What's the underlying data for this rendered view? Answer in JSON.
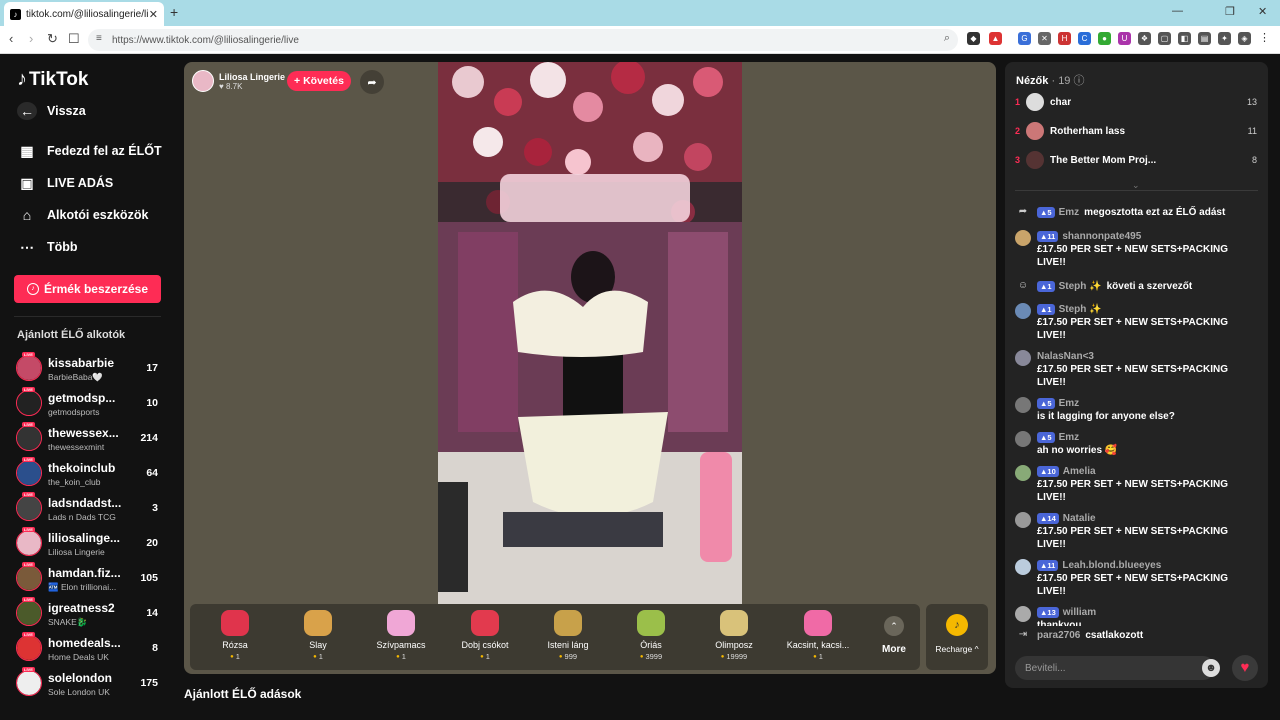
{
  "browser": {
    "tab_title": "tiktok.com/@liliosalingerie/li",
    "tab_close": "✕",
    "new_tab": "+",
    "url": "https://www.tiktok.com/@liliosalingerie/live",
    "win_minimize": "—",
    "win_maximize": "❐",
    "win_close": "✕"
  },
  "sidebar": {
    "logo": "TikTok",
    "back": "Vissza",
    "nav": [
      {
        "label": "Fedezd fel az ÉLŐT",
        "icon": "calendar-live-icon"
      },
      {
        "label": "LIVE ADÁS",
        "icon": "video-camera-icon"
      },
      {
        "label": "Alkotói eszközök",
        "icon": "creator-tools-icon"
      },
      {
        "label": "Több",
        "icon": "more-dots-icon"
      }
    ],
    "coins_button": "Érmék beszerzése",
    "section_label": "Ajánlott ÉLŐ alkotók",
    "creators": [
      {
        "name": "kissabarbie",
        "sub": "BarbieBaba🤍",
        "count": "17",
        "color": "#c44a67"
      },
      {
        "name": "getmodsp...",
        "sub": "getmodsports",
        "count": "10",
        "color": "#222"
      },
      {
        "name": "thewessex...",
        "sub": "thewessexmint",
        "count": "214",
        "color": "#333"
      },
      {
        "name": "thekoinclub",
        "sub": "the_koin_club",
        "count": "64",
        "color": "#2b4f8c"
      },
      {
        "name": "ladsndadst...",
        "sub": "Lads n Dads TCG",
        "count": "3",
        "color": "#444"
      },
      {
        "name": "liliosalinge...",
        "sub": "Liliosa Lingerie",
        "count": "20",
        "color": "#e9b8c6"
      },
      {
        "name": "hamdan.fiz...",
        "sub": "🏧 Elon trillionai...",
        "count": "105",
        "color": "#7a5a3a"
      },
      {
        "name": "igreatness2",
        "sub": "SNAKE🐉",
        "count": "14",
        "color": "#4b5a2a"
      },
      {
        "name": "homedeals...",
        "sub": "Home Deals UK",
        "count": "8",
        "color": "#d33"
      },
      {
        "name": "solelondon",
        "sub": "Sole London UK",
        "count": "175",
        "color": "#eee"
      }
    ]
  },
  "stream": {
    "host_name": "Liliosa Lingerie",
    "host_likes": "♥ 8.7K",
    "follow_label": "+ Követés",
    "share_icon": "share-icon"
  },
  "gifts": [
    {
      "name": "Rózsa",
      "price": "1",
      "color": "#e0344c"
    },
    {
      "name": "Slay",
      "price": "1",
      "color": "#d9a24a"
    },
    {
      "name": "Szívpamacs",
      "price": "1",
      "color": "#f0a7d6"
    },
    {
      "name": "Dobj csókot",
      "price": "1",
      "color": "#e23a4e"
    },
    {
      "name": "Isteni láng",
      "price": "999",
      "color": "#c8a14a"
    },
    {
      "name": "Óriás",
      "price": "3999",
      "color": "#9bbf4a"
    },
    {
      "name": "Olimposz",
      "price": "19999",
      "color": "#d9c27a"
    },
    {
      "name": "Kacsint, kacsi...",
      "price": "1",
      "color": "#f06aa6"
    }
  ],
  "more_label": "More",
  "recharge_label": "Recharge ^",
  "recommended_heading": "Ajánlott ÉLŐ adások",
  "viewers": {
    "title": "Nézők",
    "count": "· 19",
    "list": [
      {
        "rank": "1",
        "name": "char",
        "score": "13",
        "color": "#ddd"
      },
      {
        "rank": "2",
        "name": "Rotherham lass",
        "score": "11",
        "color": "#c77"
      },
      {
        "rank": "3",
        "name": "The Better Mom Proj...",
        "score": "8",
        "color": "#533"
      }
    ]
  },
  "chat": [
    {
      "type": "system",
      "level": "5",
      "user": "Emz",
      "action": "megosztotta ezt az ÉLŐ adást",
      "icon": "share-icon"
    },
    {
      "type": "comment",
      "level": "11",
      "user": "shannonpate495",
      "text": "£17.50 PER SET + NEW SETS+PACKING LIVE!!",
      "color": "#c9a46a"
    },
    {
      "type": "system",
      "level": "1",
      "user": "Steph ✨",
      "action": "követi a szervezőt",
      "icon": "follow-icon"
    },
    {
      "type": "comment",
      "level": "1",
      "user": "Steph ✨",
      "text": "£17.50 PER SET + NEW SETS+PACKING LIVE!!",
      "color": "#6a8ab5"
    },
    {
      "type": "comment",
      "level": "",
      "user": "NalasNan<3",
      "text": "£17.50 PER SET + NEW SETS+PACKING LIVE!!",
      "color": "#889"
    },
    {
      "type": "comment",
      "level": "5",
      "user": "Emz",
      "text": "is it lagging for anyone else?",
      "color": "#777"
    },
    {
      "type": "comment",
      "level": "5",
      "user": "Emz",
      "text": "ah no worries 🥰",
      "color": "#777"
    },
    {
      "type": "comment",
      "level": "10",
      "user": "Amelia",
      "text": "£17.50 PER SET + NEW SETS+PACKING LIVE!!",
      "color": "#8a7"
    },
    {
      "type": "comment",
      "level": "14",
      "user": "Natalie",
      "text": "£17.50 PER SET + NEW SETS+PACKING LIVE!!",
      "color": "#999"
    },
    {
      "type": "comment",
      "level": "11",
      "user": "Leah.blond.blueeyes",
      "text": "£17.50 PER SET + NEW SETS+PACKING LIVE!!",
      "color": "#bcd"
    },
    {
      "type": "comment",
      "level": "13",
      "user": "william",
      "text": "thankyou",
      "color": "#aaa"
    },
    {
      "type": "join",
      "level": "",
      "user": "para2706",
      "action": "csatlakozott",
      "icon": "join-icon"
    }
  ],
  "input_placeholder": "Beviteli..."
}
